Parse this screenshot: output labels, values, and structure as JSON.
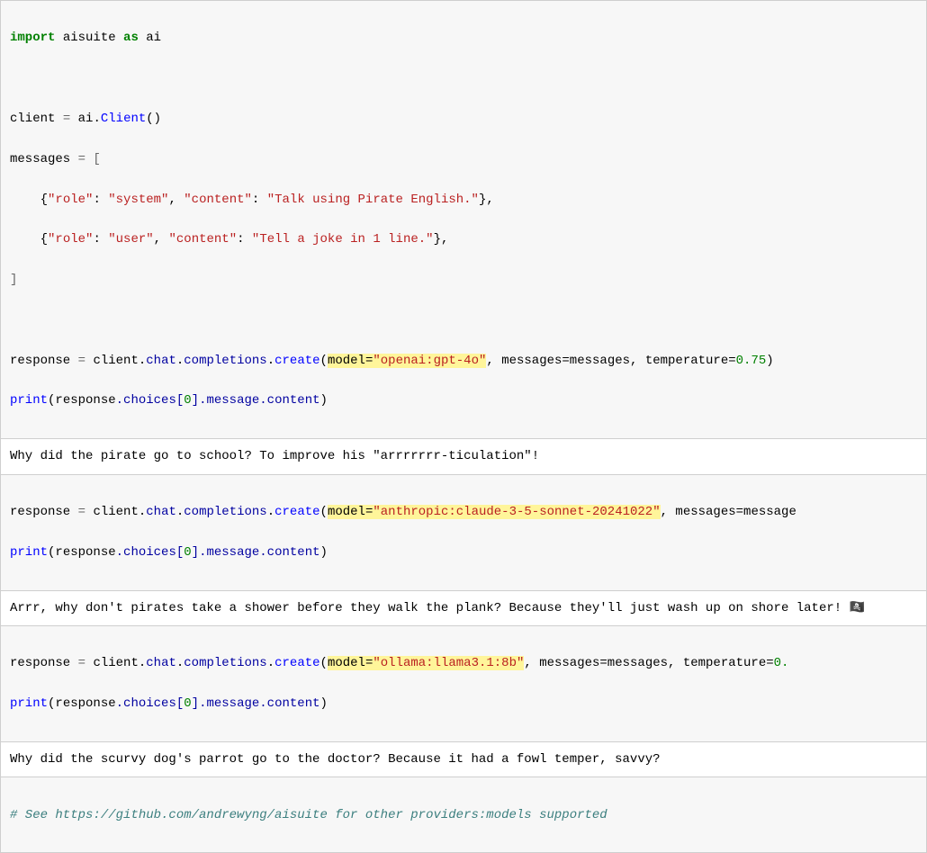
{
  "cell1": {
    "l1_import": "import",
    "l1_module": "aisuite",
    "l1_as": "as",
    "l1_alias": "ai",
    "l3_client": "client",
    "l3_eq": " = ",
    "l3_ai": "ai",
    "l3_dot": ".",
    "l3_Client": "Client",
    "l3_paren": "()",
    "l4_messages": "messages",
    "l4_eq": " = [",
    "l5_indent": "    {",
    "l5_role_k": "\"role\"",
    "l5_colon": ": ",
    "l5_role_v": "\"system\"",
    "l5_comma": ", ",
    "l5_content_k": "\"content\"",
    "l5_colon2": ": ",
    "l5_content_v": "\"Talk using Pirate English.\"",
    "l5_end": "},",
    "l6_indent": "    {",
    "l6_role_k": "\"role\"",
    "l6_colon": ": ",
    "l6_role_v": "\"user\"",
    "l6_comma": ", ",
    "l6_content_k": "\"content\"",
    "l6_colon2": ": ",
    "l6_content_v": "\"Tell a joke in 1 line.\"",
    "l6_end": "},",
    "l7_close": "]",
    "l9_response": "response",
    "l9_eq": " = ",
    "l9_chain_a": "client",
    "l9_chain_b": "chat",
    "l9_chain_c": "completions",
    "l9_chain_d": "create",
    "l9_open": "(",
    "l9_model_kw": "model",
    "l9_model_eq": "=",
    "l9_model_v": "\"openai:gpt-4o\"",
    "l9_after": ", messages=messages, temperature=",
    "l9_temp": "0.75",
    "l9_close": ")",
    "l10_print": "print",
    "l10_open": "(",
    "l10_response": "response",
    "l10_chain": ".choices[",
    "l10_zero": "0",
    "l10_chain2": "].message.content",
    "l10_close": ")"
  },
  "out1": "Why did the pirate go to school? To improve his \"arrrrrrr-ticulation\"!",
  "cell2": {
    "l1_response": "response",
    "l1_eq": " = ",
    "l1_chain_a": "client",
    "l1_chain_b": "chat",
    "l1_chain_c": "completions",
    "l1_chain_d": "create",
    "l1_open": "(",
    "l1_model_kw": "model",
    "l1_model_eq": "=",
    "l1_model_v": "\"anthropic:claude-3-5-sonnet-20241022\"",
    "l1_after": ", messages=message",
    "l2_print": "print",
    "l2_open": "(",
    "l2_response": "response",
    "l2_chain": ".choices[",
    "l2_zero": "0",
    "l2_chain2": "].message.content",
    "l2_close": ")"
  },
  "out2": "Arrr, why don't pirates take a shower before they walk the plank? Because they'll just wash up on shore later! 🏴‍☠️",
  "cell3": {
    "l1_response": "response",
    "l1_eq": " = ",
    "l1_chain_a": "client",
    "l1_chain_b": "chat",
    "l1_chain_c": "completions",
    "l1_chain_d": "create",
    "l1_open": "(",
    "l1_model_kw": "model",
    "l1_model_eq": "=",
    "l1_model_v": "\"ollama:llama3.1:8b\"",
    "l1_after": ", messages=messages, temperature=",
    "l1_temp": "0.",
    "l2_print": "print",
    "l2_open": "(",
    "l2_response": "response",
    "l2_chain": ".choices[",
    "l2_zero": "0",
    "l2_chain2": "].message.content",
    "l2_close": ")"
  },
  "out3": "Why did the scurvy dog's parrot go to the doctor? Because it had a fowl temper, savvy?",
  "cell4": {
    "comment": "# See https://github.com/andrewyng/aisuite for other providers:models supported"
  }
}
